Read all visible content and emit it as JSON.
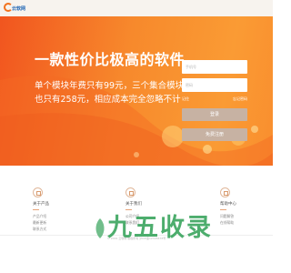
{
  "header": {
    "logo_text": "云软网"
  },
  "hero": {
    "title": "一款性价比极高的软件",
    "description": "单个模块年费只有99元，三个集合模块也只有258元，相应成本完全忽略不计"
  },
  "login": {
    "username_placeholder": "手机号",
    "password_placeholder": "密码",
    "remember_label": "记住",
    "forgot_label": "忘记密码",
    "login_button": "登录",
    "register_button": "免费注册"
  },
  "features": [
    {
      "title": "关于产品",
      "items": [
        "产品介绍",
        "最新更新",
        "联系方式"
      ]
    },
    {
      "title": "关于我们",
      "items": [
        "公司介绍",
        "联系我们"
      ]
    },
    {
      "title": "帮助中心",
      "items": [
        "问题解答",
        "在线帮助"
      ]
    }
  ],
  "footer": {
    "copyright": "© 2019 云软网 版权所有 沪ICP备12345678号"
  },
  "watermark": {
    "text": "九五收录"
  },
  "colors": {
    "hero_start": "#f1551f",
    "hero_end": "#fa9b34",
    "button": "#c7b2a3",
    "watermark": "#3aa55e"
  }
}
